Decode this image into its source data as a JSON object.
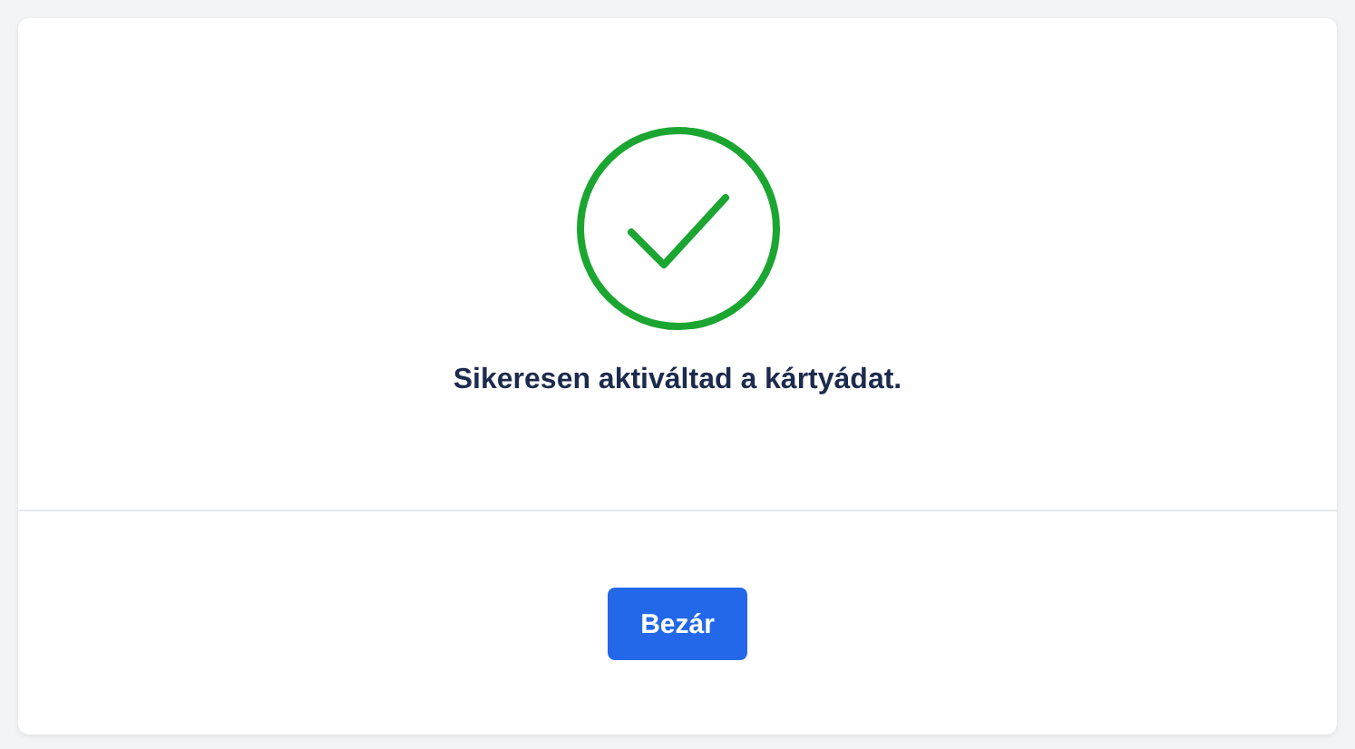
{
  "dialog": {
    "message": "Sikeresen aktiváltad a kártyádat.",
    "button": "Bezár"
  }
}
